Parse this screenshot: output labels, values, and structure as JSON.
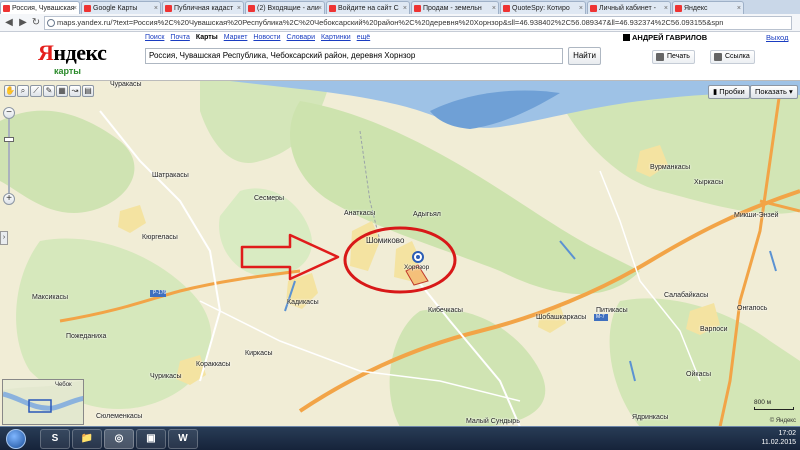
{
  "browser": {
    "tabs": [
      {
        "label": "Россия, Чувашская",
        "active": true
      },
      {
        "label": "Google Карты"
      },
      {
        "label": "Публичная кадаст"
      },
      {
        "label": "(2) Входящие - али"
      },
      {
        "label": "Войдите на сайт С"
      },
      {
        "label": "Продам - земельн"
      },
      {
        "label": "QuoteSpy: Котиро"
      },
      {
        "label": "Личный кабинет -"
      },
      {
        "label": "Яндекс"
      }
    ],
    "url": "maps.yandex.ru/?text=Россия%2C%20Чувашская%20Республика%2C%20Чебоксарский%20район%2C%20деревня%20Хорнзор&sll=46.938402%2C56.089347&ll=46.932374%2C56.093155&spn"
  },
  "header": {
    "logo": "Яндекс",
    "logo_sub": "карты",
    "services": [
      "Поиск",
      "Почта",
      "Карты",
      "Маркет",
      "Новости",
      "Словари",
      "Картинки",
      "ещё"
    ],
    "current_service": "Карты",
    "search_value": "Россия, Чувашская Республика, Чебоксарский район, деревня Хорнзор",
    "search_button": "Найти",
    "user": "АНДРЕЙ ГАВРИЛОВ",
    "logout": "Выход",
    "print": "Печать",
    "link": "Ссылка"
  },
  "map": {
    "traffic_button": "Пробки",
    "show_button": "Показать",
    "scale": "800 м",
    "copyright": "© Яндекс",
    "labels": {
      "churakasy": "Чуракасы",
      "shatrakasy": "Шатракасы",
      "sesmery": "Сесмеры",
      "kyurgelasy": "Кюргеласы",
      "anatkasy": "Анаткасы",
      "shomikovo": "Шомиково",
      "adyshyal": "Адыгьял",
      "khornzor": "Хорнзор",
      "maksimkasy": "Максикасы",
      "kadikasy": "Кадикасы",
      "pozhedaniha": "Пожеданиха",
      "kibechkasy": "Кибечкасы",
      "shobashkarkasy": "Шобашкаркасы",
      "kirkasy": "Киркасы",
      "churikasy": "Чурикасы",
      "korakkasy": "Кораккасы",
      "syulemenkasy": "Сюлеменкасы",
      "malyi_sundyr": "Малый Сундырь",
      "vurmankasy": "Вурманкасы",
      "kharkasy": "Хыркасы",
      "mikshi_enzei": "Микши-Энзей",
      "salabaikasy": "Салабайкасы",
      "ongaposy": "Онгапось",
      "pitikasy": "Питикасы",
      "varposy": "Варпоси",
      "oikasy": "Ойкасы",
      "yadrinkasy": "Ядринкасы",
      "chebok": "Чебок",
      "road_r": "Р-176",
      "road_m7": "М-7"
    }
  },
  "taskbar": {
    "apps": [
      "S",
      "📁",
      "◎",
      "▣",
      "W"
    ],
    "time": "17:02",
    "date": "11.02.2015"
  }
}
